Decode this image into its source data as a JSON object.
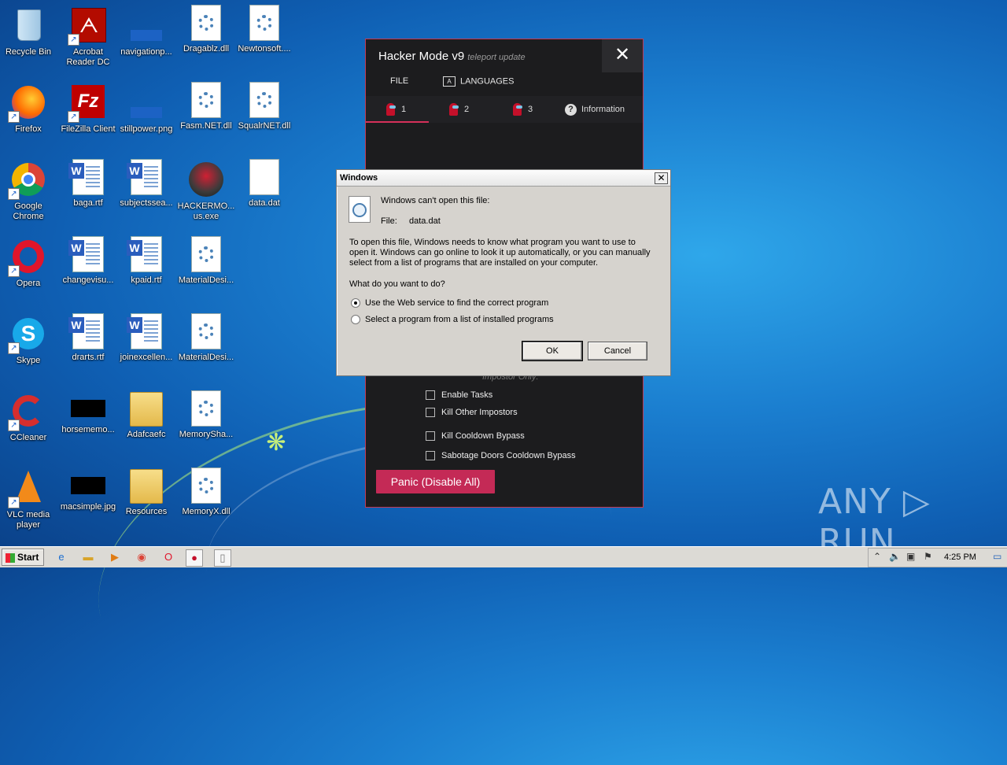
{
  "desktop": {
    "icons": [
      {
        "label": "Recycle Bin"
      },
      {
        "label": "Acrobat Reader DC"
      },
      {
        "label": "navigationp..."
      },
      {
        "label": "Dragablz.dll"
      },
      {
        "label": "Newtonsoft...."
      },
      {
        "label": "Firefox"
      },
      {
        "label": "FileZilla Client"
      },
      {
        "label": "stillpower.png"
      },
      {
        "label": "Fasm.NET.dll"
      },
      {
        "label": "SqualrNET.dll"
      },
      {
        "label": "Google Chrome"
      },
      {
        "label": "baga.rtf"
      },
      {
        "label": "subjectssea..."
      },
      {
        "label": "HACKERMO... us.exe"
      },
      {
        "label": "data.dat"
      },
      {
        "label": "Opera"
      },
      {
        "label": "changevisu..."
      },
      {
        "label": "kpaid.rtf"
      },
      {
        "label": "MaterialDesi..."
      },
      {
        "label": "Skype"
      },
      {
        "label": "drarts.rtf"
      },
      {
        "label": "joinexcellen..."
      },
      {
        "label": "MaterialDesi..."
      },
      {
        "label": "CCleaner"
      },
      {
        "label": "horsememo..."
      },
      {
        "label": "Adafcaefc"
      },
      {
        "label": "MemorySha..."
      },
      {
        "label": "VLC media player"
      },
      {
        "label": "macsimple.jpg"
      },
      {
        "label": "Resources"
      },
      {
        "label": "MemoryX.dll"
      }
    ]
  },
  "hacker_window": {
    "title": "Hacker Mode v9",
    "subtitle": "teleport update",
    "close_glyph": "✕",
    "menu": {
      "file": "FILE",
      "languages": "LANGUAGES"
    },
    "tabs": [
      "1",
      "2",
      "3",
      "Information"
    ],
    "hidden_label": "Impostor Only:",
    "options": [
      "Enable Tasks",
      "Kill Other Impostors",
      "Kill Cooldown Bypass",
      "Sabotage Doors Cooldown Bypass"
    ],
    "panic_button": "Panic (Disable All)",
    "accent_color": "#c42a56"
  },
  "dialog": {
    "title": "Windows",
    "close_glyph": "✕",
    "heading": "Windows can't open this file:",
    "file_label": "File:",
    "file_name": "data.dat",
    "explanation_line1": "To open this file, Windows needs to know what program you want to use to",
    "explanation_line2": "open it. Windows can go online to look it up automatically, or you can manually",
    "explanation_line3": "select from a list of programs that are installed on your computer.",
    "question": "What do you want to do?",
    "option_web": "Use the Web service to find the correct program",
    "option_list": "Select a program from a list of installed programs",
    "selected_option": "web",
    "ok_label": "OK",
    "cancel_label": "Cancel"
  },
  "watermark": "ANY ▷ RUN",
  "taskbar": {
    "start_label": "Start",
    "clock": "4:25 PM"
  }
}
